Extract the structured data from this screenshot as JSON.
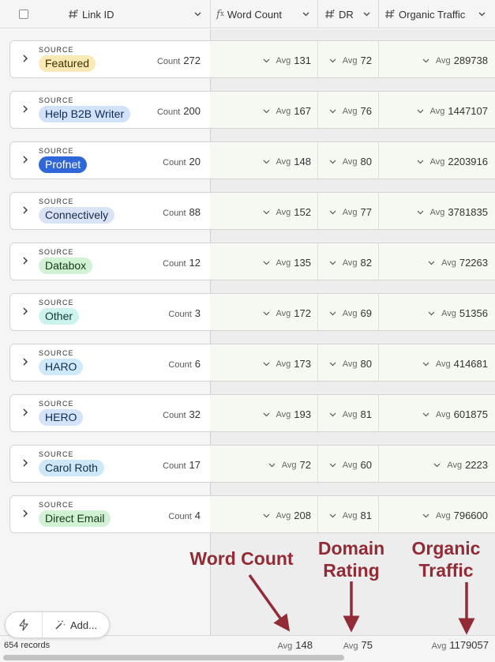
{
  "header": {
    "columns": [
      {
        "label": "Link ID",
        "icon": "hash-sparkle-icon"
      },
      {
        "label": "Word Count",
        "icon": "formula-icon"
      },
      {
        "label": "DR",
        "icon": "hash-sparkle-icon"
      },
      {
        "label": "Organic Traffic",
        "icon": "hash-sparkle-icon"
      }
    ]
  },
  "groups": [
    {
      "source_label": "SOURCE",
      "name": "Featured",
      "pill_bg": "#fbe9b5",
      "pill_fg": "#3d2f00",
      "count": "272",
      "word_count": "131",
      "dr": "72",
      "traffic": "289738"
    },
    {
      "source_label": "SOURCE",
      "name": "Help B2B Writer",
      "pill_bg": "#d2e2fb",
      "pill_fg": "#0f2a57",
      "count": "200",
      "word_count": "167",
      "dr": "76",
      "traffic": "1447107"
    },
    {
      "source_label": "SOURCE",
      "name": "Profnet",
      "pill_bg": "#2f67d8",
      "pill_fg": "#ffffff",
      "count": "20",
      "word_count": "148",
      "dr": "80",
      "traffic": "2203916"
    },
    {
      "source_label": "SOURCE",
      "name": "Connectively",
      "pill_bg": "#d9e3f5",
      "pill_fg": "#1a2a4a",
      "count": "88",
      "word_count": "152",
      "dr": "77",
      "traffic": "3781835"
    },
    {
      "source_label": "SOURCE",
      "name": "Databox",
      "pill_bg": "#d3f1d5",
      "pill_fg": "#123a17",
      "count": "12",
      "word_count": "135",
      "dr": "82",
      "traffic": "72263"
    },
    {
      "source_label": "SOURCE",
      "name": "Other",
      "pill_bg": "#cdf3ee",
      "pill_fg": "#0e3a35",
      "count": "3",
      "word_count": "172",
      "dr": "69",
      "traffic": "51356"
    },
    {
      "source_label": "SOURCE",
      "name": "HARO",
      "pill_bg": "#d0e8fb",
      "pill_fg": "#0f2d47",
      "count": "6",
      "word_count": "173",
      "dr": "80",
      "traffic": "414681"
    },
    {
      "source_label": "SOURCE",
      "name": "HERO",
      "pill_bg": "#d5e3fa",
      "pill_fg": "#0f2a57",
      "count": "32",
      "word_count": "193",
      "dr": "81",
      "traffic": "601875"
    },
    {
      "source_label": "SOURCE",
      "name": "Carol Roth",
      "pill_bg": "#cfe8f9",
      "pill_fg": "#0f2d47",
      "count": "17",
      "word_count": "72",
      "dr": "60",
      "traffic": "2223"
    },
    {
      "source_label": "SOURCE",
      "name": "Direct Email",
      "pill_bg": "#d3f1d5",
      "pill_fg": "#123a17",
      "count": "4",
      "word_count": "208",
      "dr": "81",
      "traffic": "796600"
    }
  ],
  "labels": {
    "count": "Count",
    "avg": "Avg"
  },
  "footer": {
    "records": "654 records",
    "word_count": "148",
    "dr": "75",
    "traffic": "1179057"
  },
  "actions": {
    "add_label": "Add..."
  },
  "annotations": {
    "word_count": "Word Count",
    "domain_rating": "Domain\nRating",
    "organic_traffic": "Organic\nTraffic"
  },
  "colors": {
    "annotation": "#922b36"
  }
}
